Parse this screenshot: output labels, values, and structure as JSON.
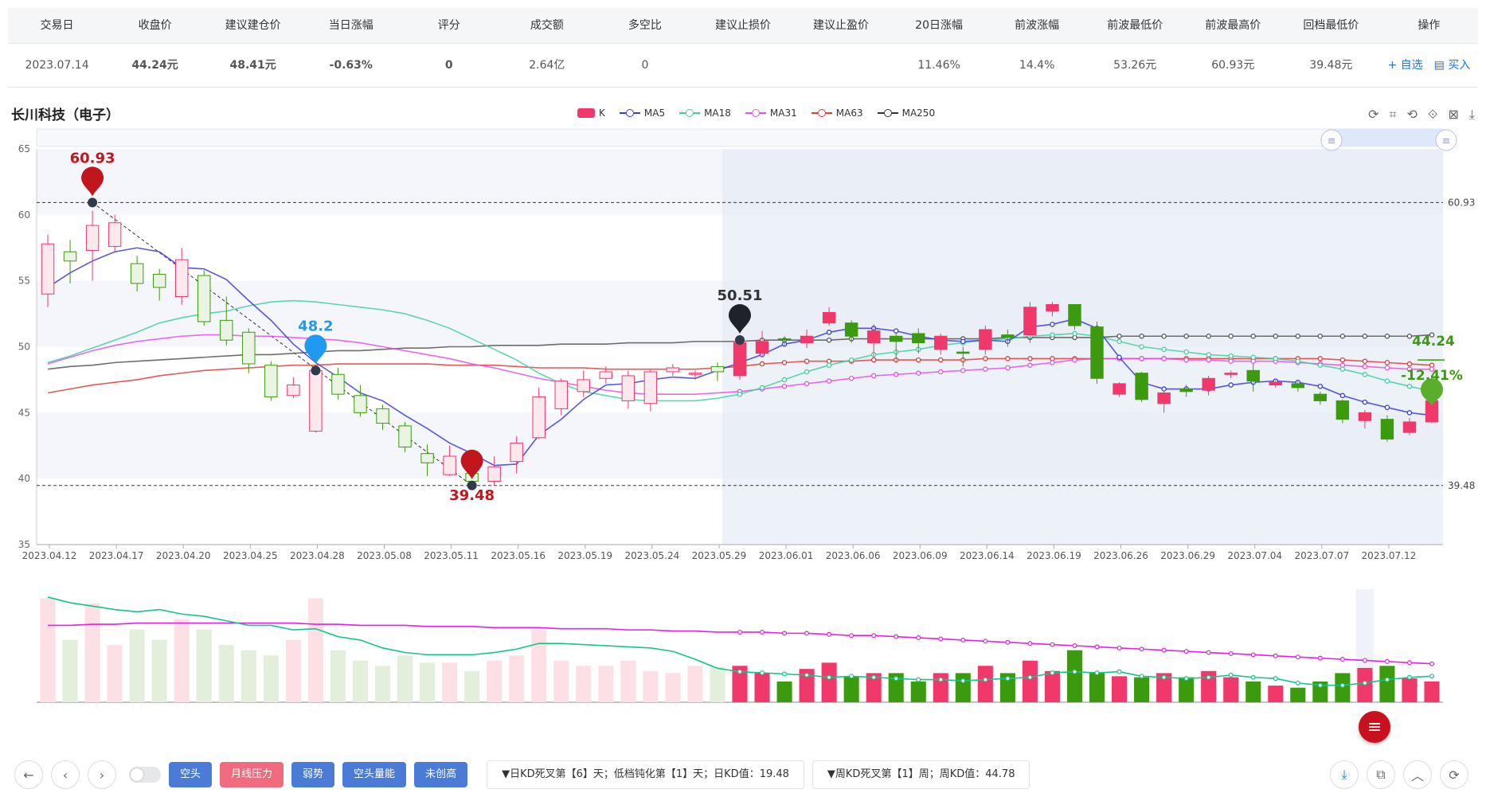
{
  "table": {
    "headers": [
      "交易日",
      "收盘价",
      "建议建仓价",
      "当日涨幅",
      "评分",
      "成交额",
      "多空比",
      "建议止损价",
      "建议止盈价",
      "20日涨幅",
      "前波涨幅",
      "前波最低价",
      "前波最高价",
      "回档最低价",
      "操作"
    ],
    "row": {
      "date": "2023.07.14",
      "close": "44.24元",
      "build_price": "48.41元",
      "day_change": "-0.63%",
      "score": "0",
      "turnover": "2.64亿",
      "ls_ratio": "0",
      "stop_loss": "",
      "take_profit": "",
      "chg20": "11.46%",
      "prev_wave_chg": "14.4%",
      "prev_wave_low": "53.26元",
      "prev_wave_high": "60.93元",
      "pullback_low": "39.48元",
      "op_watch": "+ 自选",
      "op_buy": "买入"
    }
  },
  "chart_title": "长川科技（电子）",
  "legend": {
    "k": "K",
    "ma5": "MA5",
    "ma18": "MA18",
    "ma31": "MA31",
    "ma63": "MA63",
    "ma250": "MA250"
  },
  "colors": {
    "up": "#f0386b",
    "down": "#3c9a0f",
    "ma5": "#3b3bdc",
    "ma18": "#3fd0a0",
    "ma31": "#e64ee6",
    "ma63": "#e23b3b",
    "ma250": "#333333"
  },
  "chart_data": {
    "type": "candlestick",
    "ylim": [
      35,
      65
    ],
    "yticks": [
      "65",
      "60",
      "55",
      "50",
      "45",
      "40",
      "35"
    ],
    "xticks": [
      "2023.04.12",
      "2023.04.17",
      "2023.04.20",
      "2023.04.25",
      "2023.04.28",
      "2023.05.08",
      "2023.05.11",
      "2023.05.16",
      "2023.05.19",
      "2023.05.24",
      "2023.05.29",
      "2023.06.01",
      "2023.06.06",
      "2023.06.09",
      "2023.06.14",
      "2023.06.19",
      "2023.06.26",
      "2023.06.29",
      "2023.07.04",
      "2023.07.07",
      "2023.07.12"
    ],
    "candles": [
      [
        54.0,
        57.8,
        58.5,
        53.0
      ],
      [
        57.2,
        56.5,
        58.1,
        54.8
      ],
      [
        57.3,
        59.2,
        60.3,
        55.0
      ],
      [
        57.6,
        59.4,
        60.0,
        57.2
      ],
      [
        56.3,
        54.8,
        56.9,
        54.2
      ],
      [
        55.5,
        54.5,
        55.9,
        53.5
      ],
      [
        53.8,
        56.6,
        57.5,
        53.2
      ],
      [
        55.4,
        51.9,
        55.8,
        51.6
      ],
      [
        52.0,
        50.5,
        53.8,
        50.1
      ],
      [
        51.1,
        48.7,
        51.4,
        48.0
      ],
      [
        48.6,
        46.2,
        48.9,
        45.9
      ],
      [
        46.3,
        47.1,
        47.7,
        46.1
      ],
      [
        43.6,
        48.2,
        48.2,
        43.5
      ],
      [
        47.9,
        46.4,
        48.4,
        46.0
      ],
      [
        46.3,
        45.0,
        47.1,
        44.7
      ],
      [
        45.3,
        44.2,
        45.6,
        43.7
      ],
      [
        44.0,
        42.4,
        44.3,
        42.0
      ],
      [
        41.9,
        41.2,
        42.6,
        40.2
      ],
      [
        40.3,
        41.7,
        42.5,
        40.2
      ],
      [
        40.4,
        39.8,
        40.7,
        39.5
      ],
      [
        39.8,
        40.9,
        41.7,
        39.5
      ],
      [
        41.3,
        42.7,
        43.2,
        40.4
      ],
      [
        43.1,
        46.2,
        46.9,
        43.0
      ],
      [
        45.3,
        47.4,
        47.6,
        44.8
      ],
      [
        46.6,
        47.5,
        48.2,
        46.2
      ],
      [
        47.6,
        48.1,
        48.5,
        47.2
      ],
      [
        45.9,
        47.8,
        48.2,
        45.3
      ],
      [
        45.7,
        48.1,
        48.3,
        45.1
      ],
      [
        48.1,
        48.4,
        48.7,
        47.8
      ],
      [
        47.9,
        48.0,
        48.2,
        47.5
      ],
      [
        48.5,
        48.1,
        48.8,
        47.4
      ],
      [
        47.8,
        50.3,
        50.3,
        47.5
      ],
      [
        49.5,
        50.4,
        51.2,
        49.3
      ],
      [
        50.6,
        50.5,
        50.8,
        50.1
      ],
      [
        50.3,
        50.8,
        51.3,
        49.9
      ],
      [
        51.8,
        52.6,
        53.0,
        51.6
      ],
      [
        51.8,
        50.8,
        52.0,
        50.3
      ],
      [
        50.3,
        51.2,
        51.7,
        49.2
      ],
      [
        50.8,
        50.4,
        51.1,
        48.8
      ],
      [
        51.0,
        50.3,
        51.4,
        49.5
      ],
      [
        49.8,
        50.8,
        51.0,
        49.4
      ],
      [
        49.6,
        49.5,
        50.0,
        48.5
      ],
      [
        49.8,
        51.3,
        51.6,
        49.4
      ],
      [
        50.9,
        50.7,
        51.3,
        50.0
      ],
      [
        50.9,
        53.0,
        53.4,
        50.3
      ],
      [
        52.7,
        53.2,
        53.4,
        52.3
      ],
      [
        53.2,
        51.6,
        53.2,
        51.3
      ],
      [
        51.5,
        47.6,
        51.9,
        47.2
      ],
      [
        46.4,
        47.2,
        47.3,
        46.2
      ],
      [
        48.0,
        46.0,
        48.1,
        45.8
      ],
      [
        45.7,
        46.5,
        46.6,
        45.0
      ],
      [
        46.8,
        46.6,
        47.1,
        46.2
      ],
      [
        46.7,
        47.6,
        47.8,
        46.3
      ],
      [
        47.9,
        48.0,
        48.2,
        47.6
      ],
      [
        48.2,
        47.4,
        48.7,
        46.6
      ],
      [
        47.1,
        47.3,
        47.5,
        46.9
      ],
      [
        47.2,
        46.9,
        47.4,
        46.6
      ],
      [
        46.4,
        45.9,
        46.6,
        45.6
      ],
      [
        45.9,
        44.5,
        46.0,
        44.2
      ],
      [
        44.4,
        45.0,
        45.2,
        43.8
      ],
      [
        44.5,
        43.0,
        44.8,
        42.8
      ],
      [
        43.5,
        44.3,
        44.6,
        43.3
      ],
      [
        44.3,
        45.9,
        46.0,
        44.2
      ]
    ],
    "ma5": [
      54.5,
      55.6,
      56.5,
      57.2,
      57.5,
      57.2,
      56.0,
      55.9,
      55.1,
      53.5,
      52.0,
      50.2,
      48.8,
      47.7,
      46.5,
      45.9,
      44.8,
      43.8,
      42.7,
      41.9,
      41.0,
      41.1,
      43.3,
      44.5,
      46.0,
      47.1,
      47.2,
      47.5,
      47.7,
      47.6,
      48.2,
      48.8,
      49.4,
      50.2,
      50.5,
      51.1,
      51.4,
      51.4,
      51.2,
      50.8,
      50.5,
      50.4,
      50.5,
      50.4,
      51.5,
      51.7,
      52.1,
      51.4,
      49.2,
      47.3,
      46.8,
      46.8,
      46.8,
      47.1,
      47.3,
      47.4,
      47.3,
      47.0,
      46.3,
      45.8,
      45.4,
      45.0,
      44.8
    ],
    "ma18": [
      48.8,
      49.3,
      49.9,
      50.5,
      51.1,
      51.8,
      52.2,
      52.5,
      52.7,
      53.1,
      53.4,
      53.5,
      53.4,
      53.2,
      53.0,
      52.8,
      52.5,
      52.0,
      51.4,
      50.6,
      49.8,
      49.0,
      48.0,
      47.2,
      46.6,
      46.3,
      46.0,
      45.9,
      45.9,
      45.9,
      46.1,
      46.4,
      46.9,
      47.5,
      48.1,
      48.6,
      49.0,
      49.4,
      49.6,
      49.8,
      50.1,
      50.3,
      50.5,
      50.6,
      50.8,
      50.9,
      51.0,
      50.8,
      50.4,
      50.0,
      49.8,
      49.6,
      49.4,
      49.3,
      49.2,
      49.1,
      48.9,
      48.6,
      48.3,
      47.9,
      47.4,
      47.0,
      46.6
    ],
    "ma31": [
      48.7,
      49.2,
      49.7,
      50.1,
      50.4,
      50.6,
      50.8,
      50.9,
      50.9,
      50.8,
      50.8,
      50.7,
      50.6,
      50.5,
      50.3,
      50.0,
      49.7,
      49.4,
      49.1,
      48.7,
      48.4,
      48.0,
      47.6,
      47.3,
      47.0,
      46.7,
      46.5,
      46.4,
      46.4,
      46.4,
      46.5,
      46.6,
      46.8,
      47.0,
      47.2,
      47.4,
      47.6,
      47.8,
      47.9,
      48.0,
      48.1,
      48.2,
      48.3,
      48.4,
      48.6,
      48.8,
      49.0,
      49.1,
      49.1,
      49.1,
      49.1,
      49.0,
      49.0,
      48.9,
      48.9,
      48.9,
      48.8,
      48.7,
      48.6,
      48.5,
      48.4,
      48.3,
      48.3
    ],
    "ma63": [
      46.5,
      46.8,
      47.1,
      47.3,
      47.5,
      47.8,
      48.0,
      48.2,
      48.3,
      48.4,
      48.5,
      48.6,
      48.6,
      48.7,
      48.7,
      48.7,
      48.7,
      48.7,
      48.6,
      48.6,
      48.6,
      48.5,
      48.4,
      48.4,
      48.4,
      48.3,
      48.3,
      48.3,
      48.3,
      48.3,
      48.4,
      48.5,
      48.7,
      48.8,
      48.9,
      48.9,
      48.9,
      49.0,
      49.0,
      49.0,
      49.0,
      49.0,
      49.1,
      49.1,
      49.1,
      49.1,
      49.1,
      49.1,
      49.1,
      49.1,
      49.1,
      49.1,
      49.1,
      49.1,
      49.1,
      49.1,
      49.1,
      49.1,
      49.0,
      48.9,
      48.8,
      48.7,
      48.6
    ],
    "ma250": [
      48.3,
      48.5,
      48.6,
      48.8,
      48.9,
      49.0,
      49.1,
      49.2,
      49.3,
      49.4,
      49.4,
      49.5,
      49.6,
      49.7,
      49.7,
      49.8,
      49.9,
      49.9,
      50.0,
      50.0,
      50.1,
      50.1,
      50.1,
      50.2,
      50.2,
      50.2,
      50.3,
      50.3,
      50.3,
      50.4,
      50.4,
      50.4,
      50.5,
      50.5,
      50.5,
      50.5,
      50.6,
      50.6,
      50.6,
      50.6,
      50.6,
      50.6,
      50.6,
      50.7,
      50.7,
      50.7,
      50.7,
      50.7,
      50.8,
      50.8,
      50.8,
      50.8,
      50.8,
      50.8,
      50.8,
      50.8,
      50.8,
      50.8,
      50.8,
      50.8,
      50.8,
      50.8,
      50.9
    ],
    "volumes": [
      1.0,
      0.6,
      0.95,
      0.55,
      0.7,
      0.6,
      0.8,
      0.7,
      0.55,
      0.5,
      0.45,
      0.6,
      1.0,
      0.5,
      0.4,
      0.35,
      0.45,
      0.38,
      0.38,
      0.3,
      0.4,
      0.45,
      0.7,
      0.4,
      0.35,
      0.35,
      0.4,
      0.3,
      0.28,
      0.35,
      0.34,
      0.35,
      0.28,
      0.2,
      0.32,
      0.38,
      0.25,
      0.28,
      0.28,
      0.2,
      0.28,
      0.28,
      0.35,
      0.28,
      0.4,
      0.3,
      0.5,
      0.28,
      0.25,
      0.24,
      0.28,
      0.24,
      0.3,
      0.24,
      0.2,
      0.16,
      0.14,
      0.2,
      0.28,
      0.33,
      0.35,
      0.23,
      0.2
    ],
    "vol_ma_pink": [
      0.68,
      0.68,
      0.69,
      0.69,
      0.7,
      0.7,
      0.7,
      0.7,
      0.7,
      0.7,
      0.7,
      0.7,
      0.69,
      0.69,
      0.68,
      0.68,
      0.68,
      0.67,
      0.67,
      0.67,
      0.66,
      0.66,
      0.66,
      0.65,
      0.65,
      0.65,
      0.64,
      0.64,
      0.63,
      0.63,
      0.62,
      0.62,
      0.62,
      0.61,
      0.61,
      0.6,
      0.59,
      0.59,
      0.58,
      0.57,
      0.56,
      0.55,
      0.54,
      0.53,
      0.52,
      0.51,
      0.5,
      0.49,
      0.48,
      0.47,
      0.46,
      0.45,
      0.44,
      0.43,
      0.42,
      0.41,
      0.4,
      0.39,
      0.38,
      0.37,
      0.36,
      0.35,
      0.34
    ],
    "vol_ma_teal": [
      0.93,
      0.88,
      0.85,
      0.82,
      0.8,
      0.82,
      0.78,
      0.76,
      0.72,
      0.68,
      0.68,
      0.64,
      0.65,
      0.58,
      0.55,
      0.48,
      0.44,
      0.42,
      0.42,
      0.42,
      0.44,
      0.47,
      0.52,
      0.52,
      0.51,
      0.5,
      0.49,
      0.48,
      0.45,
      0.38,
      0.3,
      0.27,
      0.26,
      0.25,
      0.24,
      0.22,
      0.23,
      0.22,
      0.21,
      0.2,
      0.2,
      0.19,
      0.2,
      0.21,
      0.22,
      0.26,
      0.27,
      0.26,
      0.27,
      0.23,
      0.22,
      0.21,
      0.22,
      0.24,
      0.22,
      0.21,
      0.17,
      0.15,
      0.15,
      0.17,
      0.2,
      0.22,
      0.23
    ],
    "marks": {
      "high_label": "60.93",
      "high_value": 60.93,
      "low_label": "39.48",
      "low_value": 39.48,
      "blue_label": "48.2",
      "blue_value": 48.2,
      "black_label": "50.51",
      "black_value": 50.51,
      "last_price": "44.24",
      "last_pct": "-12.41%"
    }
  },
  "bottom": {
    "tags": [
      "空头",
      "月线压力",
      "弱势",
      "空头量能",
      "未创高"
    ],
    "info1": "▼日KD死叉第【6】天；低档钝化第【1】天；日KD值：19.48",
    "info2": "▼周KD死叉第【1】周；周KD值：44.78"
  }
}
